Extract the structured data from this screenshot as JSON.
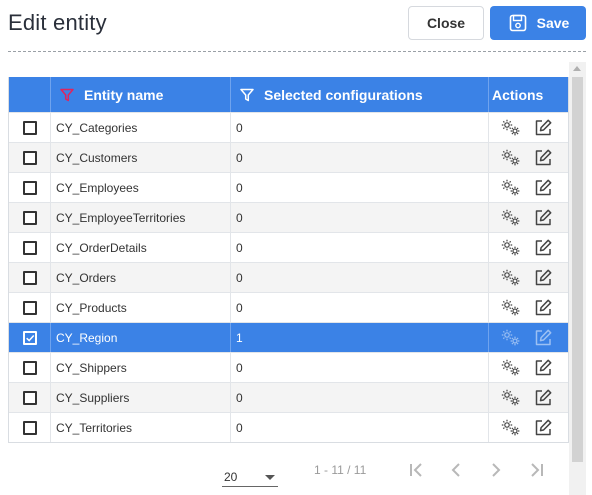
{
  "page": {
    "title": "Edit entity"
  },
  "toolbar": {
    "close_label": "Close",
    "save_label": "Save"
  },
  "grid": {
    "columns": {
      "entity_name": "Entity name",
      "selected_configurations": "Selected configurations",
      "actions": "Actions"
    },
    "rows": [
      {
        "name": "CY_Categories",
        "configurations": "0",
        "checked": false
      },
      {
        "name": "CY_Customers",
        "configurations": "0",
        "checked": false
      },
      {
        "name": "CY_Employees",
        "configurations": "0",
        "checked": false
      },
      {
        "name": "CY_EmployeeTerritories",
        "configurations": "0",
        "checked": false
      },
      {
        "name": "CY_OrderDetails",
        "configurations": "0",
        "checked": false
      },
      {
        "name": "CY_Orders",
        "configurations": "0",
        "checked": false
      },
      {
        "name": "CY_Products",
        "configurations": "0",
        "checked": false
      },
      {
        "name": "CY_Region",
        "configurations": "1",
        "checked": true
      },
      {
        "name": "CY_Shippers",
        "configurations": "0",
        "checked": false
      },
      {
        "name": "CY_Suppliers",
        "configurations": "0",
        "checked": false
      },
      {
        "name": "CY_Territories",
        "configurations": "0",
        "checked": false
      }
    ],
    "row_icons": [
      "gears-icon",
      "edit-icon"
    ]
  },
  "pager": {
    "page_size": "20",
    "range": "1 - 11 / 11"
  },
  "colors": {
    "accent": "#3b82e6",
    "filter_active": "#e0245e"
  }
}
